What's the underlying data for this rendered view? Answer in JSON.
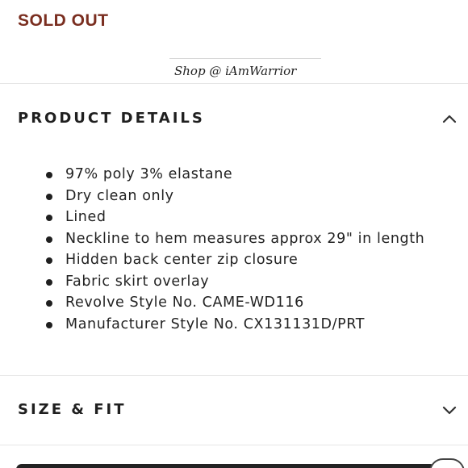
{
  "status": {
    "label": "SOLD OUT",
    "color": "#7a2e20"
  },
  "watermark": {
    "text": "Shop @ iAmWarrior"
  },
  "product_details": {
    "title": "PRODUCT DETAILS",
    "expanded": true,
    "toggle_icon": "chevron-up-icon",
    "items": [
      "97% poly 3% elastane",
      "Dry clean only",
      "Lined",
      "Neckline to hem measures approx 29\" in length",
      "Hidden back center zip closure",
      "Fabric skirt overlay",
      "Revolve Style No. CAME-WD116",
      "Manufacturer Style No. CX131131D/PRT"
    ]
  },
  "size_fit": {
    "title": "SIZE & FIT",
    "expanded": false,
    "toggle_icon": "chevron-down-icon"
  }
}
